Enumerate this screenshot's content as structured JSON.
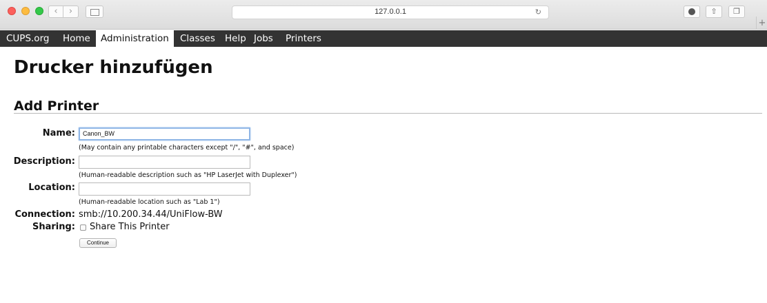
{
  "browser": {
    "url": "127.0.0.1",
    "back_glyph": "‹",
    "forward_glyph": "›",
    "reload_glyph": "↻",
    "new_tab_glyph": "+"
  },
  "nav": {
    "items": [
      {
        "label": "CUPS.org",
        "active": false
      },
      {
        "label": "Home",
        "active": false
      },
      {
        "label": "Administration",
        "active": true
      },
      {
        "label": "Classes",
        "active": false
      },
      {
        "label": "Help",
        "active": false
      },
      {
        "label": "Jobs",
        "active": false
      },
      {
        "label": "Printers",
        "active": false
      }
    ]
  },
  "page": {
    "title": "Drucker hinzufügen",
    "section_title": "Add Printer"
  },
  "form": {
    "name": {
      "label": "Name:",
      "value": "Canon_BW",
      "hint": "(May contain any printable characters except \"/\", \"#\", and space)"
    },
    "description": {
      "label": "Description:",
      "value": "",
      "hint": "(Human-readable description such as \"HP LaserJet with Duplexer\")"
    },
    "location": {
      "label": "Location:",
      "value": "",
      "hint": "(Human-readable location such as \"Lab 1\")"
    },
    "connection": {
      "label": "Connection:",
      "value": "smb://10.200.34.44/UniFlow-BW"
    },
    "sharing": {
      "label": "Sharing:",
      "checkbox_label": "Share This Printer",
      "checked": false
    },
    "continue_label": "Continue"
  },
  "colors": {
    "nav_background": "#333333",
    "focus_ring": "#8fb6e6"
  }
}
